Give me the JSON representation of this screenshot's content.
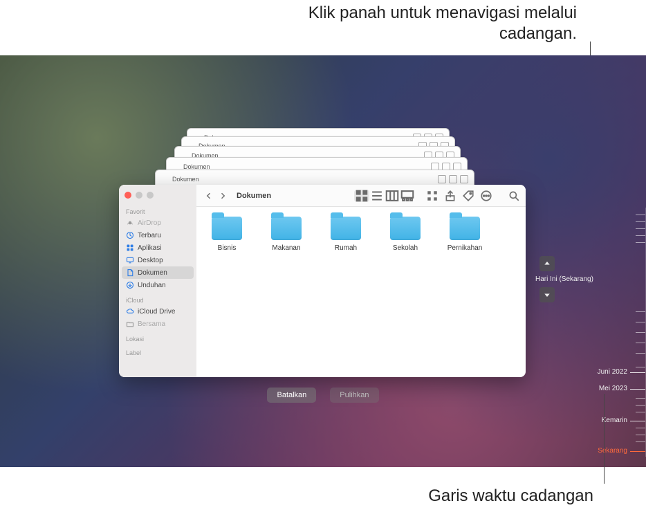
{
  "annotations": {
    "top": "Klik panah untuk menavigasi melalui cadangan.",
    "bottom": "Garis waktu cadangan"
  },
  "finder": {
    "title": "Dokumen",
    "sidebar": {
      "groups": {
        "favorit": {
          "header": "Favorit"
        },
        "icloud": {
          "header": "iCloud"
        },
        "lokasi": {
          "header": "Lokasi"
        },
        "label": {
          "header": "Label"
        }
      },
      "items": {
        "airdrop": "AirDrop",
        "terbaru": "Terbaru",
        "aplikasi": "Aplikasi",
        "desktop": "Desktop",
        "dokumen": "Dokumen",
        "unduhan": "Unduhan",
        "icloud": "iCloud Drive",
        "bersama": "Bersama"
      }
    },
    "folders": [
      {
        "label": "Bisnis"
      },
      {
        "label": "Makanan"
      },
      {
        "label": "Rumah"
      },
      {
        "label": "Sekolah"
      },
      {
        "label": "Pernikahan"
      }
    ]
  },
  "ghost_title": "Dokumen",
  "tm": {
    "status": "Hari Ini (Sekarang)"
  },
  "actions": {
    "cancel": "Batalkan",
    "restore": "Pulihkan"
  },
  "timeline": {
    "items": [
      {
        "label": "Juni 2022"
      },
      {
        "label": "Mei 2023"
      },
      {
        "label": "Kemarin"
      },
      {
        "label": "Sekarang"
      }
    ]
  }
}
